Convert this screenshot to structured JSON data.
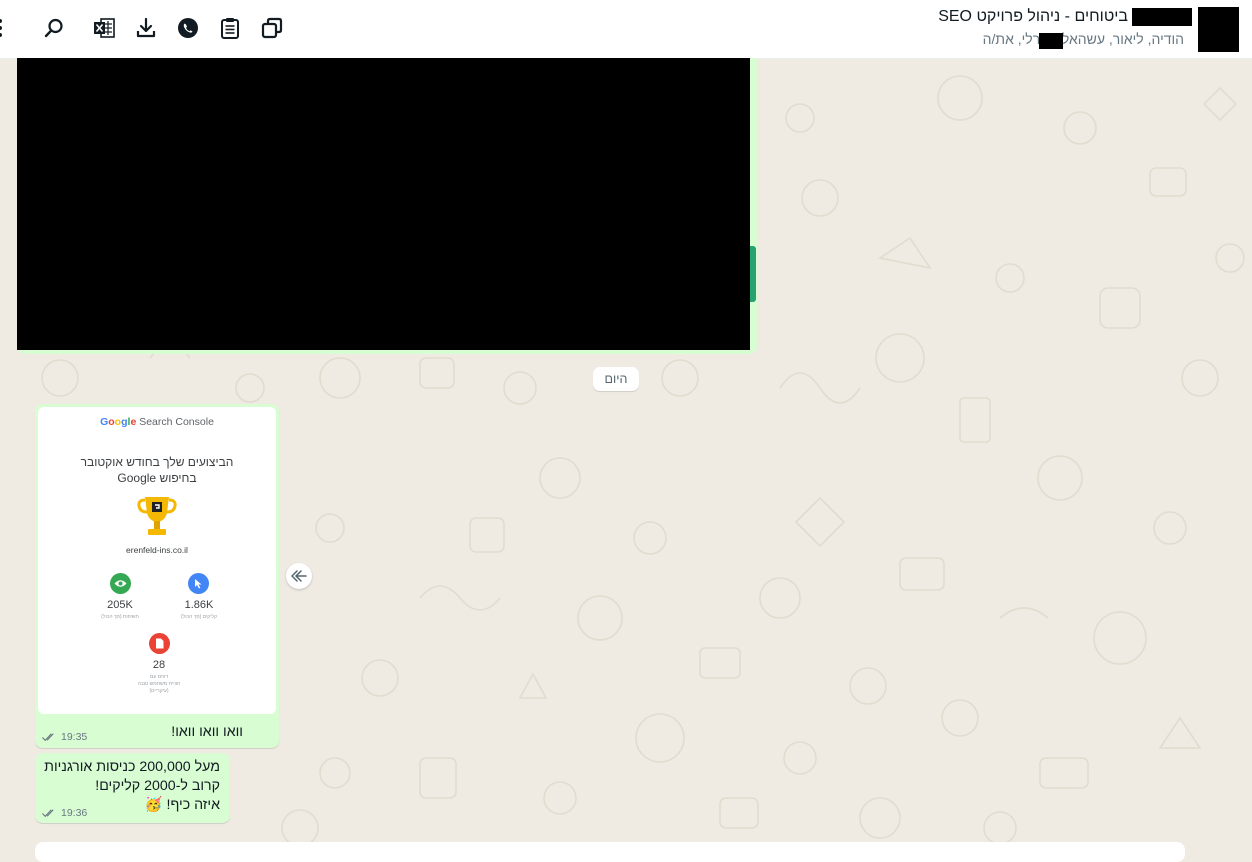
{
  "header": {
    "chat_title": "ביטוחים - ניהול פרויקט SEO",
    "members": "הודיה, ליאור, עשהאל, שירלי, את/ה",
    "icons": [
      "menu-dots-icon",
      "search-icon",
      "excel-icon",
      "download-icon",
      "whatsapp-icon",
      "clipboard-icon",
      "copy-icon"
    ]
  },
  "date_chip": "היום",
  "messages": [
    {
      "image": {
        "brand": [
          "G",
          "o",
          "o",
          "g",
          "l",
          "e"
        ],
        "product": "Search Console",
        "title_line1": "הביצועים שלך בחודש אוקטובר",
        "title_line2": "בחיפוש Google",
        "site": "erenfeld-ins.co.il",
        "stats": [
          {
            "value": "205K",
            "label": "חשיפות (סך הכול)"
          },
          {
            "value": "1.86K",
            "label": "קליקים (סך הכול)"
          },
          {
            "value": "28",
            "label_line1": "דפים עם",
            "label_line2": "חוויית משתמש טובה",
            "label_line3": "(עיקריים)"
          }
        ]
      },
      "text": "וואו וואו וואו!",
      "time": "19:35"
    },
    {
      "lines": [
        "מעל 200,000 כניסות אורגניות",
        "קרוב ל-2000 קליקים!",
        "איזה כיף! 🥳"
      ],
      "time": "19:36"
    }
  ],
  "colors": {
    "bubble_out": "#d9fdd3",
    "wallpaper": "#efeae2",
    "accent": "#25a26f",
    "green_stat": "#34a853",
    "blue_stat": "#4285f4",
    "red_stat": "#ea4335",
    "trophy": "#f5b800"
  }
}
